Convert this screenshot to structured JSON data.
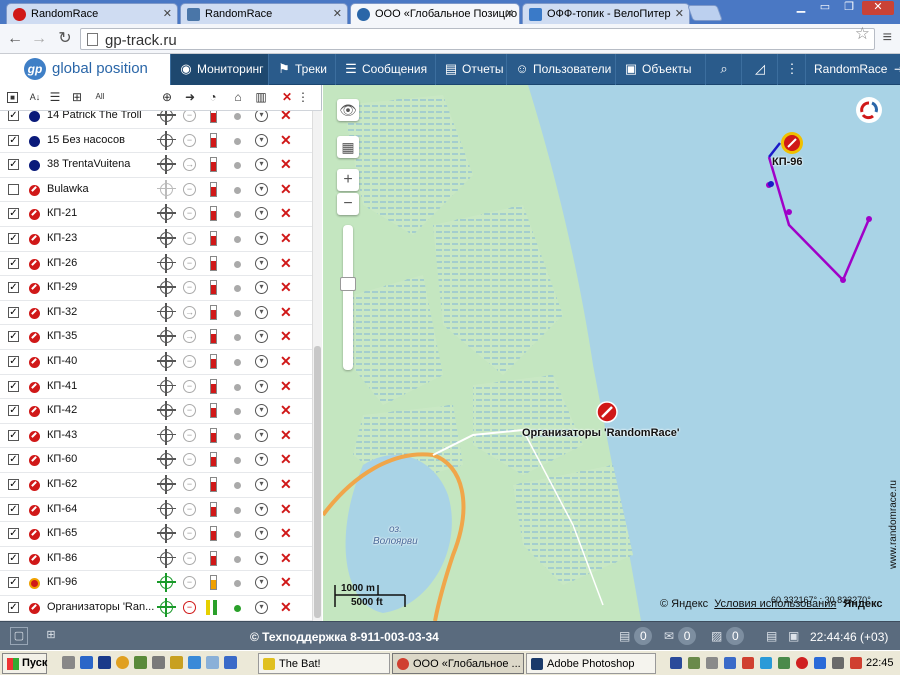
{
  "browser": {
    "tabs": [
      {
        "label": "RandomRace",
        "active": false
      },
      {
        "label": "RandomRace",
        "active": false
      },
      {
        "label": "ООО «Глобальное Позицио",
        "active": true
      },
      {
        "label": "ОФФ-топик - ВелоПитер",
        "active": false
      }
    ],
    "url": "gp-track.ru"
  },
  "app": {
    "logo_text": "global position",
    "nav": {
      "monitoring": "Мониторинг",
      "tracks": "Треки",
      "messages": "Сообщения",
      "reports": "Отчеты",
      "users": "Пользователи",
      "objects": "Объекты",
      "account": "RandomRace"
    }
  },
  "objects": [
    {
      "name": "14 Patrick The Troll",
      "checked": true,
      "marker": "navy"
    },
    {
      "name": "15 Без насосов",
      "checked": true,
      "marker": "navy"
    },
    {
      "name": "38 TrentaVuitena",
      "checked": true,
      "marker": "navy"
    },
    {
      "name": "Bulawka",
      "checked": false,
      "marker": "red"
    },
    {
      "name": "КП-21",
      "checked": true,
      "marker": "red"
    },
    {
      "name": "КП-23",
      "checked": true,
      "marker": "red"
    },
    {
      "name": "КП-26",
      "checked": true,
      "marker": "red"
    },
    {
      "name": "КП-29",
      "checked": true,
      "marker": "red"
    },
    {
      "name": "КП-32",
      "checked": true,
      "marker": "red"
    },
    {
      "name": "КП-35",
      "checked": true,
      "marker": "red"
    },
    {
      "name": "КП-40",
      "checked": true,
      "marker": "red"
    },
    {
      "name": "КП-41",
      "checked": true,
      "marker": "red"
    },
    {
      "name": "КП-42",
      "checked": true,
      "marker": "red"
    },
    {
      "name": "КП-43",
      "checked": true,
      "marker": "red"
    },
    {
      "name": "КП-60",
      "checked": true,
      "marker": "red"
    },
    {
      "name": "КП-62",
      "checked": true,
      "marker": "red"
    },
    {
      "name": "КП-64",
      "checked": true,
      "marker": "red"
    },
    {
      "name": "КП-65",
      "checked": true,
      "marker": "red"
    },
    {
      "name": "КП-86",
      "checked": true,
      "marker": "red"
    },
    {
      "name": "КП-96",
      "checked": true,
      "marker": "orange"
    },
    {
      "name": "Организаторы 'Ran...",
      "checked": true,
      "marker": "red"
    }
  ],
  "map": {
    "marker_kp96": "КП-96",
    "marker_org": "Организаторы 'RandomRace'",
    "lake_prefix": "оз.",
    "lake_name": "Волоярви",
    "scale_m": "1000 m",
    "scale_ft": "5000 ft",
    "copyright": "© Яндекс",
    "terms_link": "Условия использования",
    "yandex": "Яндекс",
    "coords": "60.332167° : 30.833270°",
    "watermark": "www.randomrace.ru"
  },
  "status": {
    "support": "© Техподдержка 8-911-003-03-34",
    "count_messages": "0",
    "count_sent": "0",
    "count_photos": "0",
    "time": "22:44:46 (+03)"
  },
  "taskbar": {
    "start": "Пуск",
    "tasks": [
      "The Bat!",
      "ООО «Глобальное ...",
      "Adobe Photoshop"
    ],
    "clock": "22:45"
  }
}
